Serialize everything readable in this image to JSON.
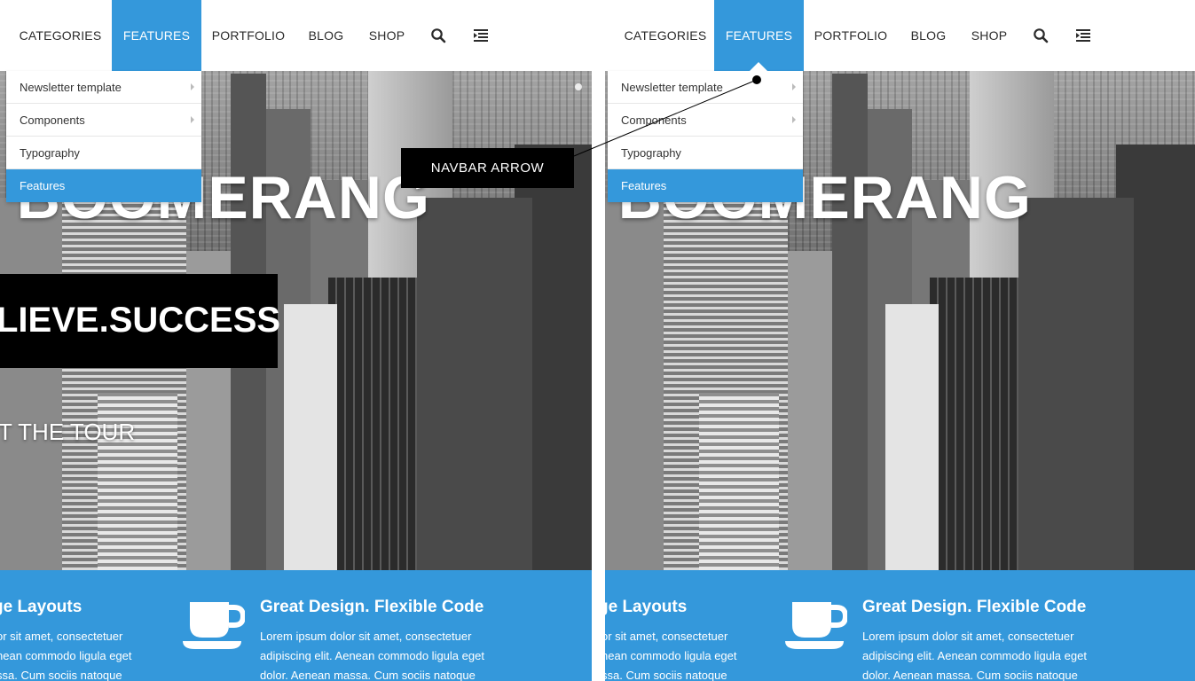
{
  "nav": {
    "items": [
      "CATEGORIES",
      "FEATURES",
      "PORTFOLIO",
      "BLOG",
      "SHOP"
    ],
    "active": "FEATURES",
    "icons": [
      "search-icon",
      "menu-icon"
    ]
  },
  "dropdown": {
    "items": [
      {
        "label": "Newsletter template",
        "has_submenu": true
      },
      {
        "label": "Components",
        "has_submenu": true
      },
      {
        "label": "Typography",
        "has_submenu": false
      },
      {
        "label": "Features",
        "has_submenu": false,
        "active": true
      }
    ]
  },
  "hero": {
    "title": "O BOOMERANG",
    "tagline": "LIEVE.SUCCESS",
    "tour": "T THE TOUR"
  },
  "band": {
    "col1_title": "ge Layouts",
    "col1_lines": [
      "or sit amet, consectetuer",
      "nean commodo ligula eget",
      "ssa. Cum sociis natoque"
    ],
    "col2_title": "Great Design. Flexible Code",
    "col2_lines": [
      "Lorem ipsum dolor sit amet, consectetuer",
      "adipiscing elit. Aenean commodo ligula eget",
      "dolor. Aenean massa. Cum sociis natoque"
    ],
    "col2_icon": "coffee-cup-icon"
  },
  "annotation": {
    "label": "NAVBAR ARROW"
  },
  "colors": {
    "accent": "#3498db",
    "callout_bg": "#000000",
    "band_bg": "#3498db"
  }
}
